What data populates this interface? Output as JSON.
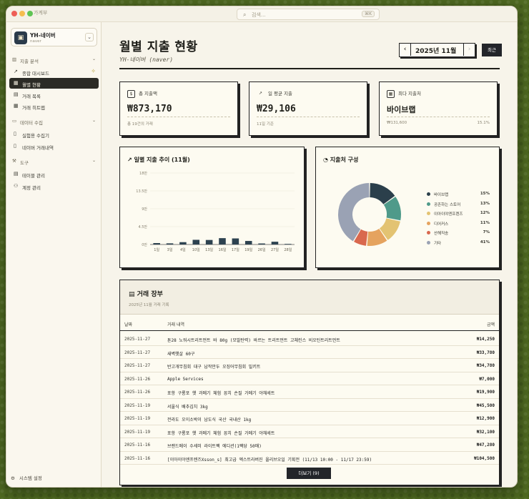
{
  "app": {
    "title": "가계부"
  },
  "search": {
    "placeholder": "검색...",
    "shortcut": "⌘K"
  },
  "account": {
    "name": "YH-네이버",
    "sub": "naver"
  },
  "sidebar": {
    "sections": [
      {
        "label": "지출 분석",
        "items": [
          {
            "label": "종합 대시보드"
          },
          {
            "label": "월별 현황"
          },
          {
            "label": "거래 목록"
          },
          {
            "label": "거래 히트맵"
          }
        ]
      },
      {
        "label": "데이터 수집",
        "items": [
          {
            "label": "실험용 수집기"
          },
          {
            "label": "네이버 거래내역"
          }
        ]
      },
      {
        "label": "도구",
        "items": [
          {
            "label": "테이블 관리"
          },
          {
            "label": "계정 관리"
          }
        ]
      }
    ],
    "settings": "시스템 설정"
  },
  "header": {
    "title": "월별 지출 현황",
    "subtitle": "YH-네이버 (naver)",
    "month": "2025년 11월",
    "recent": "최근"
  },
  "stats": [
    {
      "label": "총 지출액",
      "value": "₩873,170",
      "foot": "총 19건의 거래",
      "foot2": ""
    },
    {
      "label": "일 평균 지출",
      "value": "₩29,106",
      "foot": "11일 기준",
      "foot2": ""
    },
    {
      "label": "최다 지출처",
      "value": "바이브랩",
      "foot": "₩131,600",
      "foot2": "15.1%"
    }
  ],
  "trend": {
    "title": "일별 지출 추이 (11월)"
  },
  "composition": {
    "title": "지출처 구성"
  },
  "chart_data": [
    {
      "type": "bar",
      "title": "일별 지출 추이 (11월)",
      "categories": [
        "1일",
        "3일",
        "4일",
        "10일",
        "13일",
        "16일",
        "17일",
        "19일",
        "26일",
        "27일",
        "28일"
      ],
      "values": [
        3600,
        2900,
        5900,
        11800,
        11400,
        16000,
        15300,
        8900,
        2600,
        7000,
        1500
      ],
      "yticks": [
        "0만",
        "4.5만",
        "9만",
        "13.5만",
        "18만"
      ],
      "ylim": [
        0,
        180000
      ],
      "color": "#2d4250"
    },
    {
      "type": "pie",
      "title": "지출처 구성",
      "slices": [
        {
          "label": "바이브랩",
          "value": 15,
          "pct": "15%",
          "color": "#2b3f4b"
        },
        {
          "label": "공존하는 스토어",
          "value": 13,
          "pct": "13%",
          "color": "#4f9a8a"
        },
        {
          "label": "이아이야엔프렌즈",
          "value": 12,
          "pct": "12%",
          "color": "#e3c372"
        },
        {
          "label": "디어커스",
          "value": 11,
          "pct": "11%",
          "color": "#e5a35f"
        },
        {
          "label": "산해직송",
          "value": 7,
          "pct": "7%",
          "color": "#d9684e"
        },
        {
          "label": "기타",
          "value": 41,
          "pct": "41%",
          "color": "#9aa2b4"
        }
      ]
    }
  ],
  "ledger": {
    "title": "거래 장부",
    "subtitle": "2025년 11월 거래 기록",
    "columns": {
      "date": "날짜",
      "desc": "거래 내역",
      "amount": "금액"
    },
    "rows": [
      {
        "date": "2025-11-27",
        "desc": "톤28 노워시트리트먼트 바 80g (모발탄력) 바르는 트리트먼트 고체린스 비오틴트리트먼트",
        "amount": "₩14,250"
      },
      {
        "date": "2025-11-27",
        "desc": "새벽햇살 60구",
        "amount": "₩33,780"
      },
      {
        "date": "2025-11-27",
        "desc": "반고개무침회 대구 납작만두 오징어무침회 밀키트",
        "amount": "₩34,780"
      },
      {
        "date": "2025-11-26",
        "desc": "Apple Services",
        "amount": "₩7,000"
      },
      {
        "date": "2025-11-26",
        "desc": "포항 구룡포 햇 과메기 체험 꽁치 손질 가메기 야채세트",
        "amount": "₩19,900"
      },
      {
        "date": "2025-11-19",
        "desc": "서울식 배추김치 3kg",
        "amount": "₩45,500"
      },
      {
        "date": "2025-11-19",
        "desc": "전라도 오이소박이 남도식 국산 국내산 1kg",
        "amount": "₩12,900"
      },
      {
        "date": "2025-11-19",
        "desc": "포항 구룡포 햇 과메기 체험 꽁치 손질 가메기 야채세트",
        "amount": "₩32,100"
      },
      {
        "date": "2025-11-16",
        "desc": "브랜드메이 수세미 라이트팩 에디션(1팩당 50매)",
        "amount": "₩47,280"
      },
      {
        "date": "2025-11-16",
        "desc": "[이아이야엔프렌즈Xsson_s] 최고급 엑스트라버진 올리브오일 기획전 (11/13 10:00 - 11/17 23:59)",
        "amount": "₩104,500"
      }
    ],
    "more": "더보기 (9)"
  }
}
